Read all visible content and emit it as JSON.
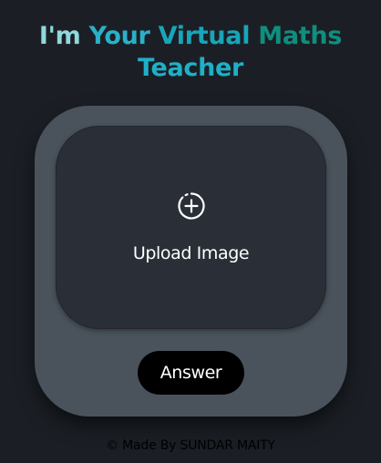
{
  "title": {
    "line1": {
      "word1": "I'm",
      "word2": "Your",
      "word3": "Virtual",
      "word4": "Maths"
    },
    "line2": "Teacher"
  },
  "upload": {
    "label": "Upload Image",
    "icon": "add-circle-dashed-icon"
  },
  "answer_button": {
    "label": "Answer"
  },
  "footer": {
    "symbol": "©",
    "text": "Made By SUNDAR MAITY"
  },
  "colors": {
    "background": "#1b1f25",
    "card": "#4a535c",
    "upload_area": "#2a2f37",
    "button": "#000000",
    "title_light": "#8fd8dc",
    "title_teal": "#18a5b9",
    "title_green": "#0e8f7e"
  }
}
